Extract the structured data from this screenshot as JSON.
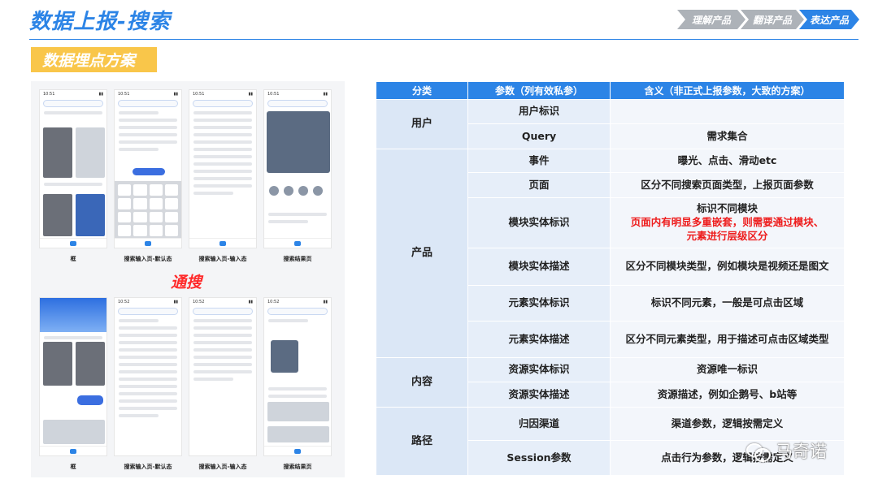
{
  "header": {
    "title": "数据上报-搜索",
    "steps": [
      "理解产品",
      "翻译产品",
      "表达产品"
    ],
    "section_tag": "数据埋点方案"
  },
  "screenshots": {
    "labels_top": [
      "框",
      "搜索输入页-默认态",
      "搜索输入页-输入态",
      "搜索结果页"
    ],
    "middle_title": "通搜",
    "labels_bottom": [
      "框",
      "搜索输入页-默认态",
      "搜索输入页-输入态",
      "搜索结果页"
    ]
  },
  "table": {
    "headers": [
      "分类",
      "参数（列有效私参）",
      "含义（非正式上报参数，大致的方案）"
    ],
    "rows": [
      {
        "param": "用户标识",
        "desc": ""
      },
      {
        "param": "Query",
        "desc": "需求集合"
      },
      {
        "param": "事件",
        "desc": "曝光、点击、滑动etc"
      },
      {
        "param": "页面",
        "desc": "区分不同搜索页面类型，上报页面参数"
      },
      {
        "param": "模块实体标识",
        "desc": "标识不同模块",
        "desc_red_1": "页面内有明显多重嵌套，则需要通过模块、",
        "desc_red_2": "元素进行层级区分"
      },
      {
        "param": "模块实体描述",
        "desc": "区分不同模块类型，例如模块是视频还是图文"
      },
      {
        "param": "元素实体标识",
        "desc": "标识不同元素，一般是可点击区域"
      },
      {
        "param": "元素实体描述",
        "desc": "区分不同元素类型，用于描述可点击区域类型"
      },
      {
        "param": "资源实体标识",
        "desc": "资源唯一标识"
      },
      {
        "param": "资源实体描述",
        "desc": "资源描述，例如企鹅号、b站等"
      },
      {
        "param": "归因渠道",
        "desc": "渠道参数，逻辑按需定义"
      },
      {
        "param": "Session参数",
        "desc": "点击行为参数，逻辑按需定义"
      }
    ],
    "categories": [
      "用户",
      "产品",
      "内容",
      "路径"
    ]
  },
  "watermark": "马奇诺",
  "colors": {
    "accent": "#2c84e6",
    "tag": "#f9c64a",
    "highlight": "#ee1c1c"
  }
}
